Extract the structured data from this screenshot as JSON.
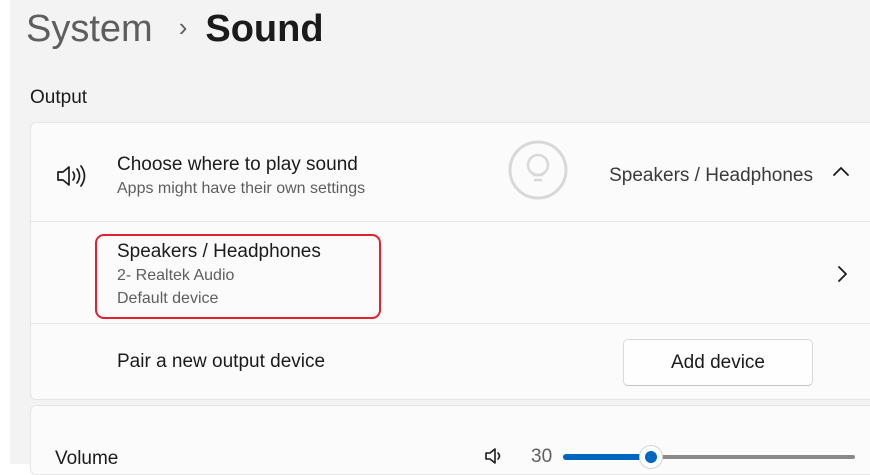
{
  "breadcrumb": {
    "parent": "System",
    "separator": "›",
    "current": "Sound"
  },
  "output": {
    "section_label": "Output",
    "choose": {
      "title": "Choose where to play sound",
      "subtitle": "Apps might have their own settings",
      "selected_value": "Speakers / Headphones",
      "icon": "speaker-icon",
      "expand_icon": "chevron-up-icon"
    },
    "device": {
      "name": "Speakers / Headphones",
      "detail": "2- Realtek Audio",
      "status": "Default device",
      "highlight_color": "#e0212e"
    },
    "pair": {
      "label": "Pair a new output device",
      "button_label": "Add device"
    }
  },
  "volume": {
    "label": "Volume",
    "value": "30",
    "level_percent": 30,
    "icon": "speaker-low-icon"
  },
  "colors": {
    "accent": "#0067c0",
    "background": "#f3f3f3",
    "card": "#fbfbfb"
  }
}
